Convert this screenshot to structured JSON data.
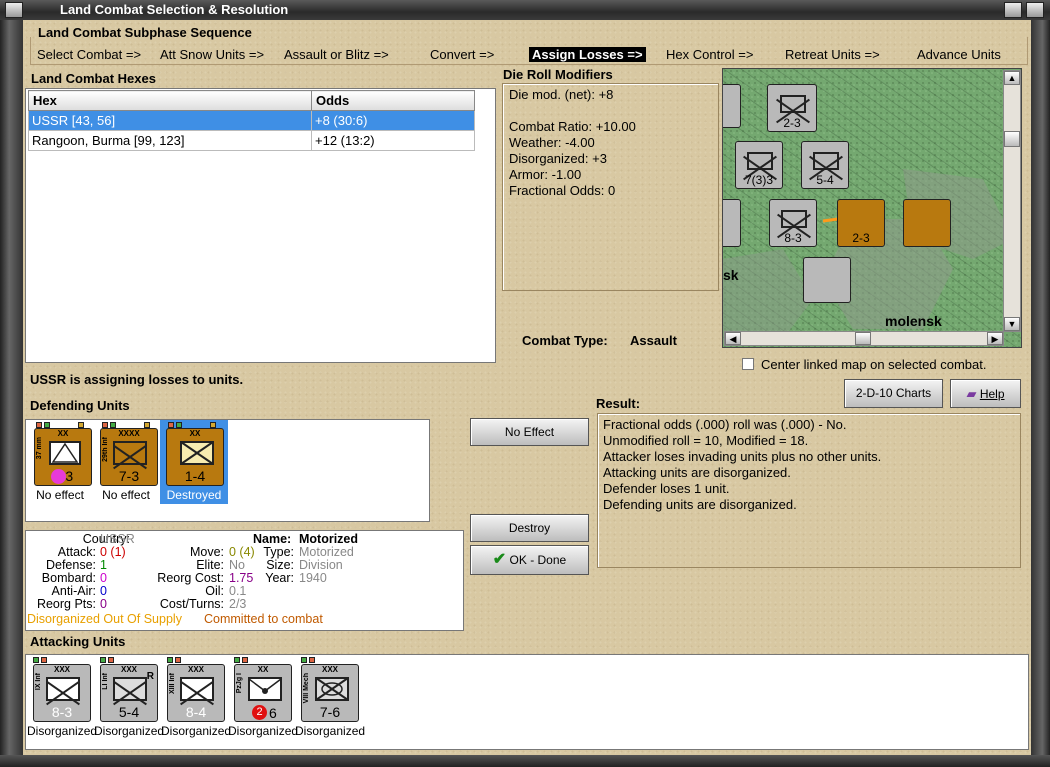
{
  "window": {
    "title": "Land Combat Selection & Resolution"
  },
  "sequence": {
    "title": "Land Combat Subphase Sequence",
    "steps": [
      "Select Combat =>",
      "Att Snow Units =>",
      "Assault or Blitz =>",
      "Convert =>",
      "Assign Losses =>",
      "Hex Control =>",
      "Retreat Units =>",
      "Advance Units"
    ],
    "active": "Assign Losses =>"
  },
  "hexes": {
    "title": "Land Combat Hexes",
    "columns": [
      "Hex",
      "Odds"
    ],
    "rows": [
      {
        "hex": "USSR [43, 56]",
        "odds": "+8 (30:6)"
      },
      {
        "hex": "Rangoon, Burma [99, 123]",
        "odds": "+12 (13:2)"
      }
    ]
  },
  "die_roll": {
    "title": "Die Roll Modifiers",
    "net": "Die mod. (net): +8",
    "lines": [
      "Combat Ratio: +10.00",
      "Weather: -4.00",
      "Disorganized: +3",
      "Armor: -1.00",
      "Fractional Odds: 0"
    ]
  },
  "combat_type": {
    "label": "Combat Type:",
    "value": "Assault"
  },
  "map": {
    "label": "molensk",
    "label2": "sk",
    "center_label": "Center linked map on selected combat."
  },
  "status": "USSR is assigning losses to units.",
  "defending": {
    "title": "Defending Units",
    "units": [
      {
        "size": "XX",
        "side": "37 mm",
        "str": "2-3",
        "caption": "No effect",
        "icon": "artillery-icon"
      },
      {
        "size": "XXXX",
        "side": "29th Inf",
        "str": "7-3",
        "caption": "No effect",
        "icon": "infantry-icon"
      },
      {
        "size": "XX",
        "side": "",
        "str": "1-4",
        "caption": "Destroyed",
        "icon": "motorized-icon"
      }
    ]
  },
  "buttons": {
    "no_effect": "No Effect",
    "destroy": "Destroy",
    "ok_done": "OK - Done",
    "charts": "2-D-10 Charts",
    "help": "Help"
  },
  "result": {
    "title": "Result:",
    "lines": [
      "Fractional odds (.000) roll was (.000)  - No.",
      "Unmodified roll = 10, Modified = 18.",
      "Attacker loses invading units plus no other units.",
      "Attacking units are disorganized.",
      "Defender loses 1 unit.",
      "Defending units are disorganized."
    ]
  },
  "details": {
    "country_l": "Country:",
    "country": "USSR",
    "attack_l": "Attack:",
    "attack": "0 (1)",
    "defense_l": "Defense:",
    "defense": "1",
    "bombard_l": "Bombard:",
    "bombard": "0",
    "antiair_l": "Anti-Air:",
    "antiair": "0",
    "reorgpts_l": "Reorg Pts:",
    "reorgpts": "0",
    "name_l": "Name:",
    "name": "Motorized",
    "move_l": "Move:",
    "move": "0 (4)",
    "elite_l": "Elite:",
    "elite": "No",
    "reorgcost_l": "Reorg Cost:",
    "reorgcost": "1.75",
    "oil_l": "Oil:",
    "oil": "0.1",
    "costturns_l": "Cost/Turns:",
    "costturns": "2/3",
    "type_l": "Type:",
    "type": "Motorized",
    "size_l": "Size:",
    "size": "Division",
    "year_l": "Year:",
    "year": "1940",
    "status1": "Disorganized Out Of Supply",
    "status2": "Committed to combat"
  },
  "attacking": {
    "title": "Attacking Units",
    "units": [
      {
        "size": "XXX",
        "side": "IX Inf",
        "str": "8-3",
        "caption": "Disorganized"
      },
      {
        "size": "XXX",
        "side": "LI Inf",
        "str": "5-4",
        "caption": "Disorganized",
        "flag": "R"
      },
      {
        "size": "XXX",
        "side": "XIII Inf",
        "str": "8-4",
        "caption": "Disorganized"
      },
      {
        "size": "XX",
        "side": "PzJg I",
        "str": "6",
        "badge": "2",
        "caption": "Disorganized"
      },
      {
        "size": "XXX",
        "side": "VIII Mech",
        "str": "7-6",
        "caption": "Disorganized"
      }
    ]
  },
  "colors": {
    "selection": "#3f8fe5",
    "counter_tan": "#b8790f",
    "counter_gray": "#b9b9b9",
    "disorg": "#e8a000",
    "committed": "#c05a00"
  }
}
